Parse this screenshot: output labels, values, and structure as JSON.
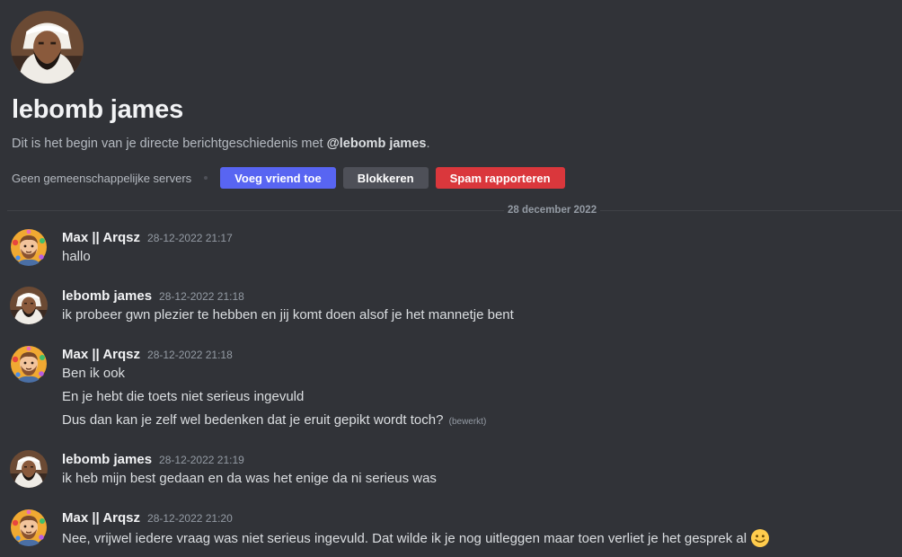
{
  "profile": {
    "name": "lebomb james",
    "intro_text": "Dit is het begin van je directe berichtgeschiedenis met",
    "intro_mention": "@lebomb james",
    "intro_end": ".",
    "mutual_servers": "Geen gemeenschappelijke servers",
    "buttons": {
      "add_friend": "Voeg vriend toe",
      "block": "Blokkeren",
      "report_spam": "Spam rapporteren"
    }
  },
  "divider_date": "28 december 2022",
  "messages": [
    {
      "author": "Max || Arqsz",
      "time": "28-12-2022 21:17",
      "avatar": "cartoon-avatar",
      "lines": [
        "hallo"
      ]
    },
    {
      "author": "lebomb james",
      "time": "28-12-2022 21:18",
      "avatar": "photo-avatar",
      "lines": [
        "ik probeer gwn plezier te hebben en jij komt doen alsof je het mannetje bent"
      ]
    },
    {
      "author": "Max || Arqsz",
      "time": "28-12-2022 21:18",
      "avatar": "cartoon-avatar",
      "lines": [
        "Ben ik ook",
        "En je hebt die toets niet serieus ingevuld",
        "Dus dan kan je zelf wel bedenken dat je eruit gepikt wordt toch?"
      ],
      "edited_label": "(bewerkt)"
    },
    {
      "author": "lebomb james",
      "time": "28-12-2022 21:19",
      "avatar": "photo-avatar",
      "lines": [
        "ik heb mijn best gedaan en da was het enige da ni serieus was"
      ]
    },
    {
      "author": "Max || Arqsz",
      "time": "28-12-2022 21:20",
      "avatar": "cartoon-avatar",
      "lines": [
        "Nee, vrijwel iedere vraag was niet serieus ingevuld. Dat wilde ik je nog uitleggen maar toen verliet je het gesprek al"
      ],
      "emoji": "slightly-smiling-face-emoji"
    }
  ],
  "colors": {
    "background": "#313338",
    "blurple": "#5865f2",
    "grey_button": "#4e5058",
    "red_button": "#da373c"
  }
}
